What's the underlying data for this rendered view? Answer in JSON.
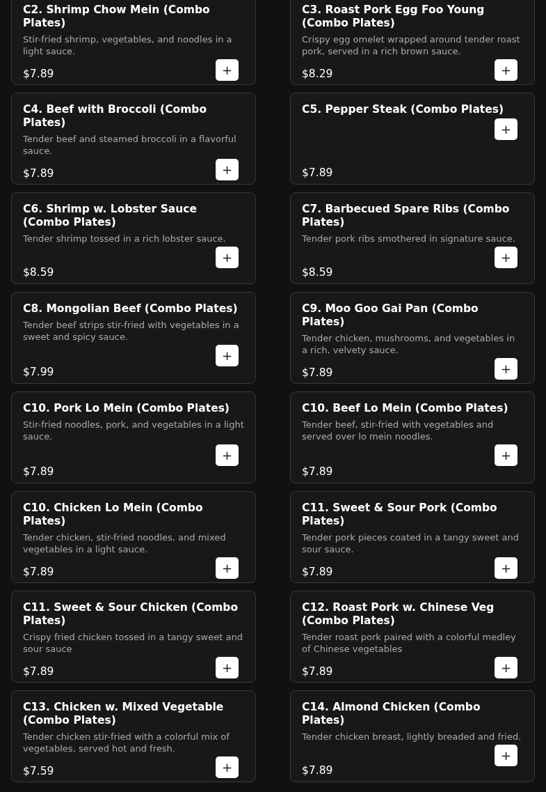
{
  "items": [
    {
      "name": "C2. Shrimp Chow Mein (Combo Plates)",
      "description": "Stir-fried shrimp, vegetables, and noodles in a light sauce.",
      "price": "$7.89",
      "add": "+"
    },
    {
      "name": "C3. Roast Pork Egg Foo Young (Combo Plates)",
      "description": "Crispy egg omelet wrapped around tender roast pork, served in a rich brown sauce.",
      "price": "$8.29",
      "add": "+"
    },
    {
      "name": "C4. Beef with Broccoli (Combo Plates)",
      "description": "Tender beef and steamed broccoli in a flavorful sauce.",
      "price": "$7.89",
      "add": "+"
    },
    {
      "name": "C5. Pepper Steak (Combo Plates)",
      "price": "$7.89",
      "add": "+"
    },
    {
      "name": "C6. Shrimp w. Lobster Sauce (Combo Plates)",
      "description": "Tender shrimp tossed in a rich lobster sauce.",
      "price": "$8.59",
      "add": "+"
    },
    {
      "name": "C7. Barbecued Spare Ribs (Combo Plates)",
      "description": "Tender pork ribs smothered in signature sauce.",
      "price": "$8.59",
      "add": "+"
    },
    {
      "name": "C8. Mongolian Beef (Combo Plates)",
      "description": "Tender beef strips stir-fried with vegetables in a sweet and spicy sauce.",
      "price": "$7.99",
      "add": "+"
    },
    {
      "name": "C9. Moo Goo Gai Pan (Combo Plates)",
      "description": "Tender chicken, mushrooms, and vegetables in a rich, velvety sauce.",
      "price": "$7.89",
      "add": "+"
    },
    {
      "name": "C10. Pork Lo Mein (Combo Plates)",
      "description": "Stir-fried noodles, pork, and vegetables in a light sauce.",
      "price": "$7.89",
      "add": "+"
    },
    {
      "name": "C10. Beef Lo Mein (Combo Plates)",
      "description": "Tender beef, stir-fried with vegetables and served over lo mein noodles.",
      "price": "$7.89",
      "add": "+"
    },
    {
      "name": "C10. Chicken Lo Mein (Combo Plates)",
      "description": "Tender chicken, stir-fried noodles, and mixed vegetables in a light sauce.",
      "price": "$7.89",
      "add": "+"
    },
    {
      "name": "C11. Sweet & Sour Pork (Combo Plates)",
      "description": "Tender pork pieces coated in a tangy sweet and sour sauce.",
      "price": "$7.89",
      "add": "+"
    },
    {
      "name": "C11. Sweet & Sour Chicken (Combo Plates)",
      "description": "Crispy fried chicken tossed in a tangy sweet and sour sauce",
      "price": "$7.89",
      "add": "+"
    },
    {
      "name": "C12. Roast Pork w. Chinese Veg (Combo Plates)",
      "description": "Tender roast pork paired with a colorful medley of Chinese vegetables",
      "price": "$7.89",
      "add": "+"
    },
    {
      "name": "C13. Chicken w. Mixed Vegetable (Combo Plates)",
      "description": "Tender chicken stir-fried with a colorful mix of vegetables, served hot and fresh.",
      "price": "$7.59",
      "add": "+"
    },
    {
      "name": "C14. Almond Chicken (Combo Plates)",
      "description": "Tender chicken breast, lightly breaded and fried.",
      "price": "$7.89",
      "add": "+"
    }
  ]
}
